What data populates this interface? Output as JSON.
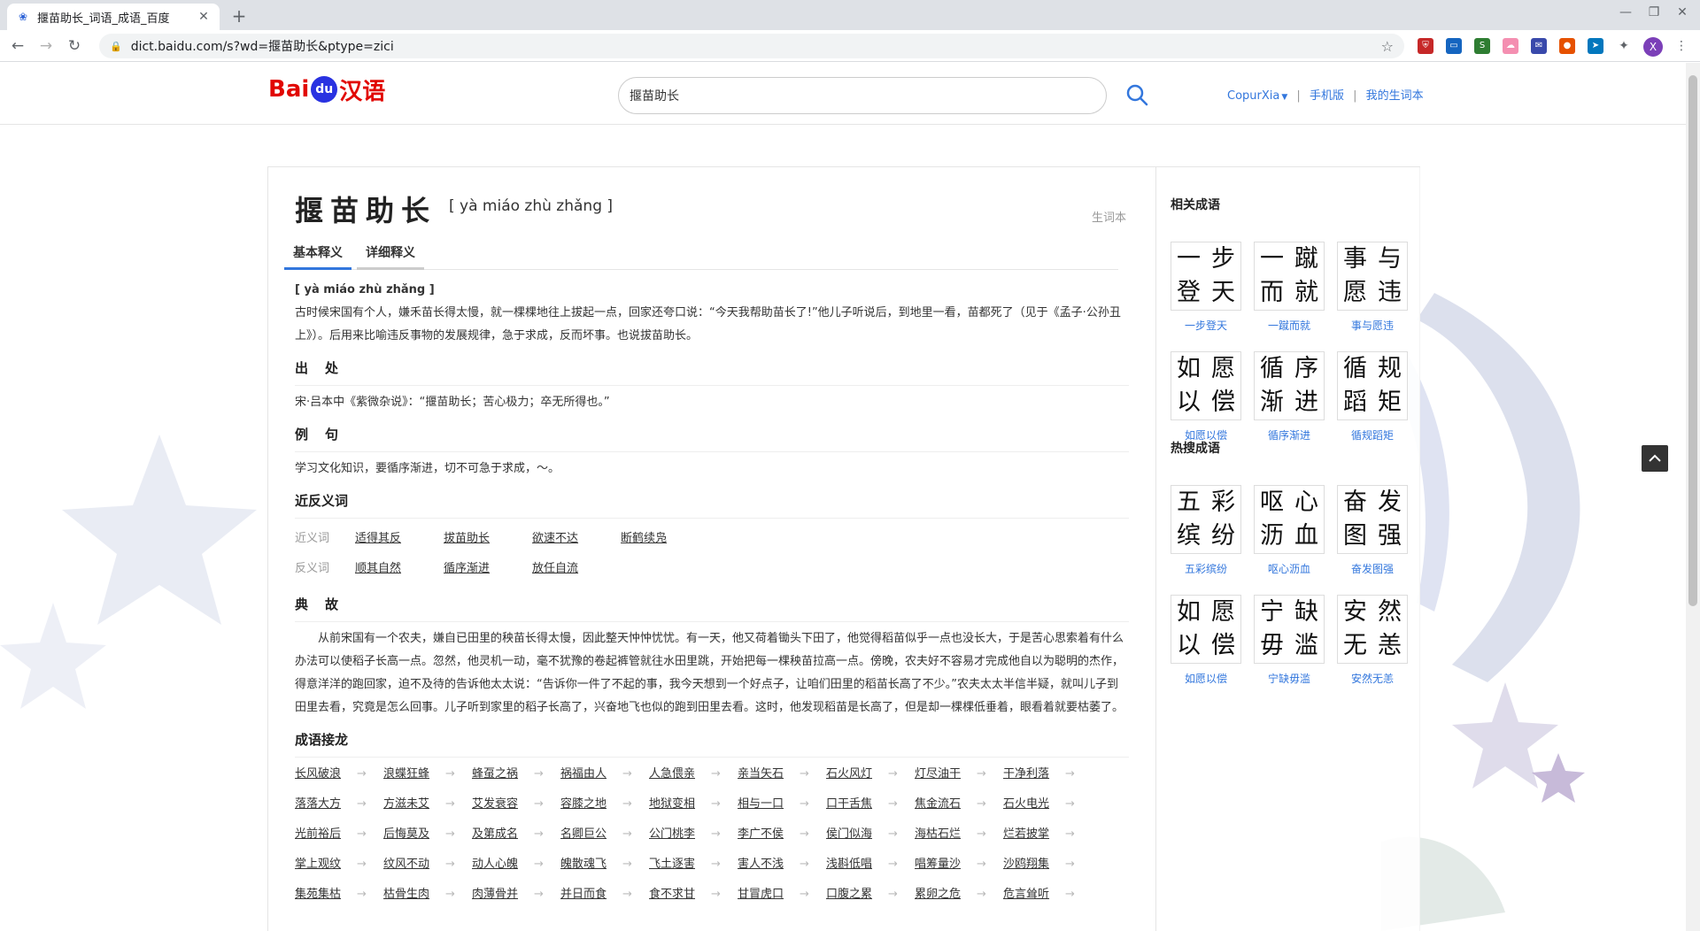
{
  "browser": {
    "tab_title": "揠苗助长_词语_成语_百度",
    "url": "dict.baidu.com/s?wd=揠苗助长&ptype=zici",
    "profile_initial": "X"
  },
  "header": {
    "logo_bai": "Bai",
    "logo_du": "du",
    "logo_hanyu": "汉语",
    "search_value": "揠苗助长",
    "user_link": "CopurXia",
    "mobile_link": "手机版",
    "vocab_link": "我的生词本"
  },
  "entry": {
    "word": "揠苗助长",
    "pinyin": "[ yà miáo zhù zhǎng ]",
    "add_vocab": "生词本",
    "tabs": [
      "基本释义",
      "详细释义"
    ],
    "basic_pinyin": "[ yà miáo zhù zhǎng ]",
    "definition": "古时候宋国有个人，嫌禾苗长得太慢，就一棵棵地往上拔起一点，回家还夸口说：“今天我帮助苗长了!”他儿子听说后，到地里一看，苗都死了（见于《孟子·公孙丑上》）。后用来比喻违反事物的发展规律，急于求成，反而坏事。也说拔苗助长。",
    "source_title": "出　处",
    "source_text": "宋·吕本中《紫微杂说》：“揠苗助长；苦心极力；卒无所得也。”",
    "example_title": "例　句",
    "example_text": "学习文化知识，要循序渐进，切不可急于求成，～。",
    "synant_title": "近反义词",
    "synonym_label": "近义词",
    "synonyms": [
      "适得其反",
      "拔苗助长",
      "欲速不达",
      "断鹤续凫"
    ],
    "antonym_label": "反义词",
    "antonyms": [
      "顺其自然",
      "循序渐进",
      "放任自流"
    ],
    "story_title": "典　故",
    "story_text": "从前宋国有一个农夫，嫌自已田里的秧苗长得太慢，因此整天忡忡忧忧。有一天，他又荷着锄头下田了，他觉得稻苗似乎一点也没长大，于是苦心思索着有什么办法可以使稻子长高一点。忽然，他灵机一动，毫不犹豫的卷起裤管就往水田里跳，开始把每一棵秧苗拉高一点。傍晚，农夫好不容易才完成他自以为聪明的杰作，得意洋洋的跑回家，迫不及待的告诉他太太说：“告诉你一件了不起的事，我今天想到一个好点子，让咱们田里的稻苗长高了不少。”农夫太太半信半疑，就叫儿子到田里去看，究竟是怎么回事。儿子听到家里的稻子长高了，兴奋地飞也似的跑到田里去看。这时，他发现稻苗是长高了，但是却一棵棵低垂着，眼看着就要枯萎了。",
    "chain_title": "成语接龙",
    "chain": [
      "长风破浪",
      "浪蝶狂蜂",
      "蜂虿之祸",
      "祸福由人",
      "人急偎亲",
      "亲当矢石",
      "石火风灯",
      "灯尽油干",
      "干净利落",
      "落落大方",
      "方滋未艾",
      "艾发衰容",
      "容膝之地",
      "地狱变相",
      "相与一口",
      "口干舌焦",
      "焦金流石",
      "石火电光",
      "光前裕后",
      "后悔莫及",
      "及第成名",
      "名卿巨公",
      "公门桃李",
      "李广不侯",
      "侯门似海",
      "海枯石烂",
      "烂若披掌",
      "掌上观纹",
      "纹风不动",
      "动人心魄",
      "魄散魂飞",
      "飞土逐害",
      "害人不浅",
      "浅斟低唱",
      "唱筹量沙",
      "沙鸥翔集",
      "集苑集枯",
      "枯骨生肉",
      "肉薄骨并",
      "并日而食",
      "食不求甘",
      "甘冒虎口",
      "口腹之累",
      "累卵之危",
      "危言耸听"
    ]
  },
  "aside": {
    "related_title": "相关成语",
    "related": [
      {
        "chars": [
          "一",
          "步",
          "登",
          "天"
        ],
        "name": "一步登天"
      },
      {
        "chars": [
          "一",
          "蹴",
          "而",
          "就"
        ],
        "name": "一蹴而就"
      },
      {
        "chars": [
          "事",
          "与",
          "愿",
          "违"
        ],
        "name": "事与愿违"
      },
      {
        "chars": [
          "如",
          "愿",
          "以",
          "偿"
        ],
        "name": "如愿以偿"
      },
      {
        "chars": [
          "循",
          "序",
          "渐",
          "进"
        ],
        "name": "循序渐进"
      },
      {
        "chars": [
          "循",
          "规",
          "蹈",
          "矩"
        ],
        "name": "循规蹈矩"
      }
    ],
    "hot_title": "热搜成语",
    "hot": [
      {
        "chars": [
          "五",
          "彩",
          "缤",
          "纷"
        ],
        "name": "五彩缤纷"
      },
      {
        "chars": [
          "呕",
          "心",
          "沥",
          "血"
        ],
        "name": "呕心沥血"
      },
      {
        "chars": [
          "奋",
          "发",
          "图",
          "强"
        ],
        "name": "奋发图强"
      },
      {
        "chars": [
          "如",
          "愿",
          "以",
          "偿"
        ],
        "name": "如愿以偿"
      },
      {
        "chars": [
          "宁",
          "缺",
          "毋",
          "滥"
        ],
        "name": "宁缺毋滥"
      },
      {
        "chars": [
          "安",
          "然",
          "无",
          "恙"
        ],
        "name": "安然无恙"
      }
    ]
  },
  "colors": {
    "link": "#3377dd",
    "brand_red": "#e10601",
    "brand_blue": "#2932e1"
  }
}
